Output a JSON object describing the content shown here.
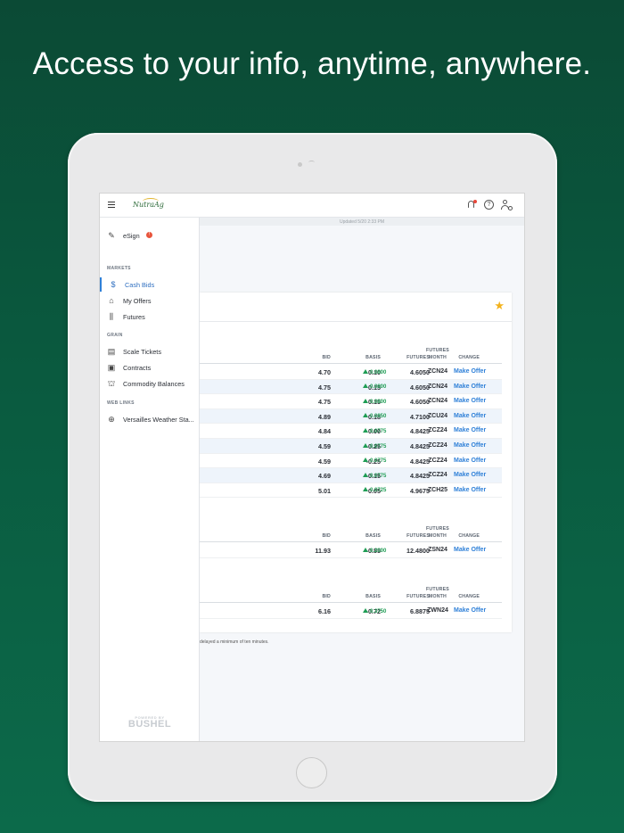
{
  "headline": "Access to your info, anytime, anywhere.",
  "app": {
    "logo_text": "NutraAg",
    "updated": "Updated 5/20 2:33 PM"
  },
  "sidebar": {
    "esign": {
      "label": "eSign",
      "badge": "!"
    },
    "sections": {
      "markets": "MARKETS",
      "grain": "GRAIN",
      "web_links": "WEB LINKS"
    },
    "markets_items": [
      {
        "label": "Cash Bids",
        "icon": "cash-bids-icon",
        "active": true
      },
      {
        "label": "My Offers",
        "icon": "tag-icon"
      },
      {
        "label": "Futures",
        "icon": "chart-icon"
      }
    ],
    "grain_items": [
      {
        "label": "Scale Tickets",
        "icon": "ticket-icon"
      },
      {
        "label": "Contracts",
        "icon": "document-icon"
      },
      {
        "label": "Commodity Balances",
        "icon": "silo-icon"
      }
    ],
    "web_items": [
      {
        "label": "Versailles Weather Sta...",
        "icon": "globe-icon"
      }
    ],
    "powered_by": "POWERED BY",
    "brand": "BUSHEL"
  },
  "table": {
    "headers": {
      "bid": "BID",
      "basis": "BASIS",
      "futures": "FUTURES",
      "change": "CHANGE",
      "futures_month_1": "FUTURES",
      "futures_month_2": "MONTH"
    },
    "action_label": "Make Offer",
    "groups": [
      {
        "rows": [
          {
            "bid": "4.70",
            "basis": "0.10",
            "futures": "4.6050",
            "change": "0.0800",
            "month": "ZCN24"
          },
          {
            "bid": "4.75",
            "basis": "0.15",
            "futures": "4.6050",
            "change": "0.0800",
            "month": "ZCN24"
          },
          {
            "bid": "4.75",
            "basis": "0.15",
            "futures": "4.6050",
            "change": "0.0800",
            "month": "ZCN24"
          },
          {
            "bid": "4.89",
            "basis": "0.18",
            "futures": "4.7100",
            "change": "0.0850",
            "month": "ZCU24"
          },
          {
            "bid": "4.84",
            "basis": "0.00",
            "futures": "4.8425",
            "change": "0.0775",
            "month": "ZCZ24"
          },
          {
            "bid": "4.59",
            "basis": "-0.25",
            "futures": "4.8425",
            "change": "0.0775",
            "month": "ZCZ24"
          },
          {
            "bid": "4.59",
            "basis": "-0.25",
            "futures": "4.8425",
            "change": "0.0775",
            "month": "ZCZ24"
          },
          {
            "bid": "4.69",
            "basis": "-0.15",
            "futures": "4.8425",
            "change": "0.0775",
            "month": "ZCZ24"
          },
          {
            "bid": "5.01",
            "basis": "0.05",
            "futures": "4.9675",
            "change": "0.0725",
            "month": "ZCH25"
          }
        ]
      },
      {
        "rows": [
          {
            "bid": "11.93",
            "basis": "-0.55",
            "futures": "12.4800",
            "change": "0.2000",
            "month": "ZSN24"
          }
        ]
      },
      {
        "rows": [
          {
            "bid": "6.16",
            "basis": "-0.72",
            "futures": "6.8875",
            "change": "0.3750",
            "month": "ZWN24"
          }
        ]
      }
    ],
    "disclaimer": "delayed a minimum of ten minutes."
  }
}
